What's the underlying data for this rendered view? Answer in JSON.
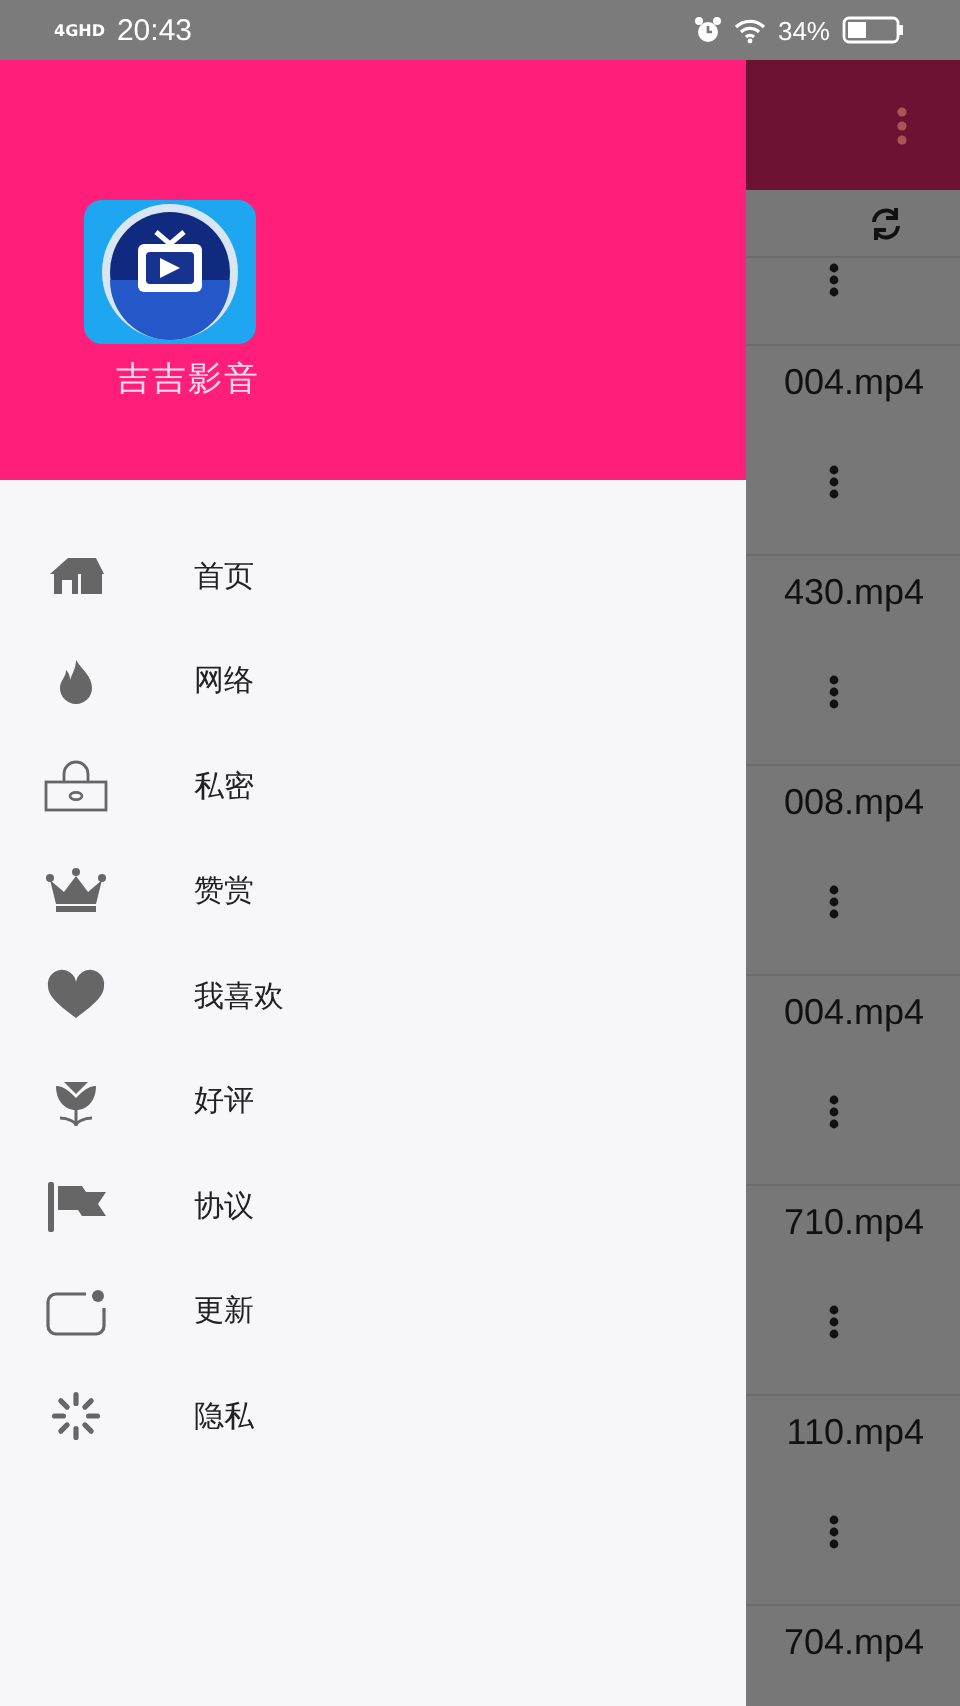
{
  "status_bar": {
    "network": "4GHD",
    "time": "20:43",
    "battery": "34%"
  },
  "files": [
    {
      "name": "004.mp4"
    },
    {
      "name": "430.mp4"
    },
    {
      "name": "008.mp4"
    },
    {
      "name": "004.mp4"
    },
    {
      "name": "710.mp4"
    },
    {
      "name": "110.mp4"
    },
    {
      "name": "704.mp4"
    }
  ],
  "drawer": {
    "app_name": "吉吉影音",
    "menu": [
      {
        "label": "首页"
      },
      {
        "label": "网络"
      },
      {
        "label": "私密"
      },
      {
        "label": "赞赏"
      },
      {
        "label": "我喜欢"
      },
      {
        "label": "好评"
      },
      {
        "label": "协议"
      },
      {
        "label": "更新"
      },
      {
        "label": "隐私"
      }
    ]
  }
}
